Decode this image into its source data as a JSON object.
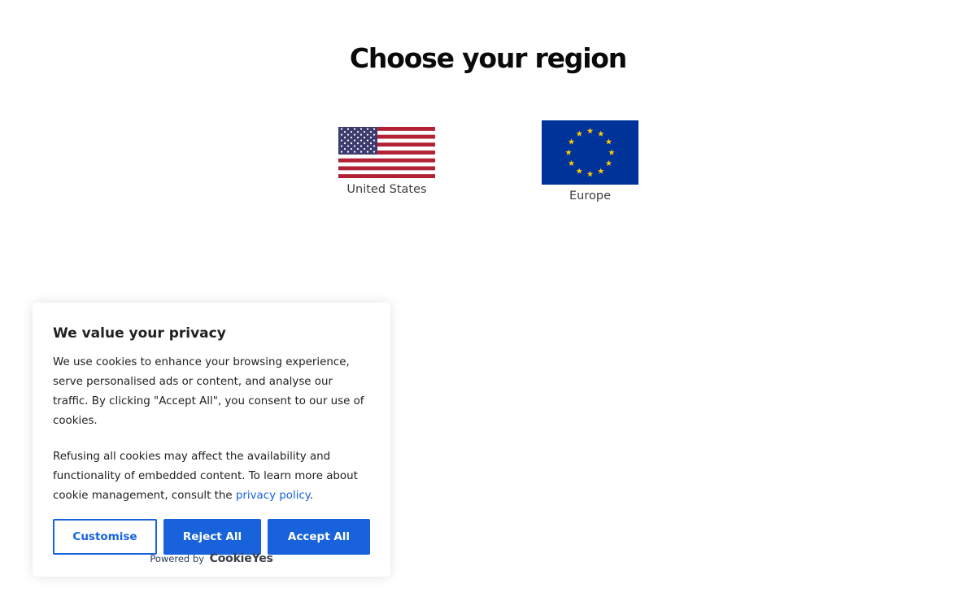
{
  "page": {
    "title": "Choose your region"
  },
  "regions": [
    {
      "label": "United States",
      "flag_icon": "us-flag-icon"
    },
    {
      "label": "Europe",
      "flag_icon": "eu-flag-icon"
    }
  ],
  "cookie_banner": {
    "title": "We value your privacy",
    "paragraph1": "We use cookies to enhance your browsing experience, serve personalised ads or content, and analyse our traffic. By clicking \"Accept All\", you consent to our use of cookies.",
    "paragraph2_prefix": "Refusing all cookies may affect the availability and functionality of embedded content. To learn more about cookie management, consult the ",
    "privacy_link": "privacy policy",
    "paragraph2_suffix": ".",
    "buttons": {
      "customise": "Customise",
      "reject": "Reject All",
      "accept": "Accept All"
    },
    "powered_by": "Powered by",
    "brand": "CookieYes"
  },
  "colors": {
    "accent": "#1863dc",
    "us_red": "#b22234",
    "us_blue": "#3c3b6e",
    "eu_blue": "#003399",
    "eu_star": "#ffcc00"
  }
}
